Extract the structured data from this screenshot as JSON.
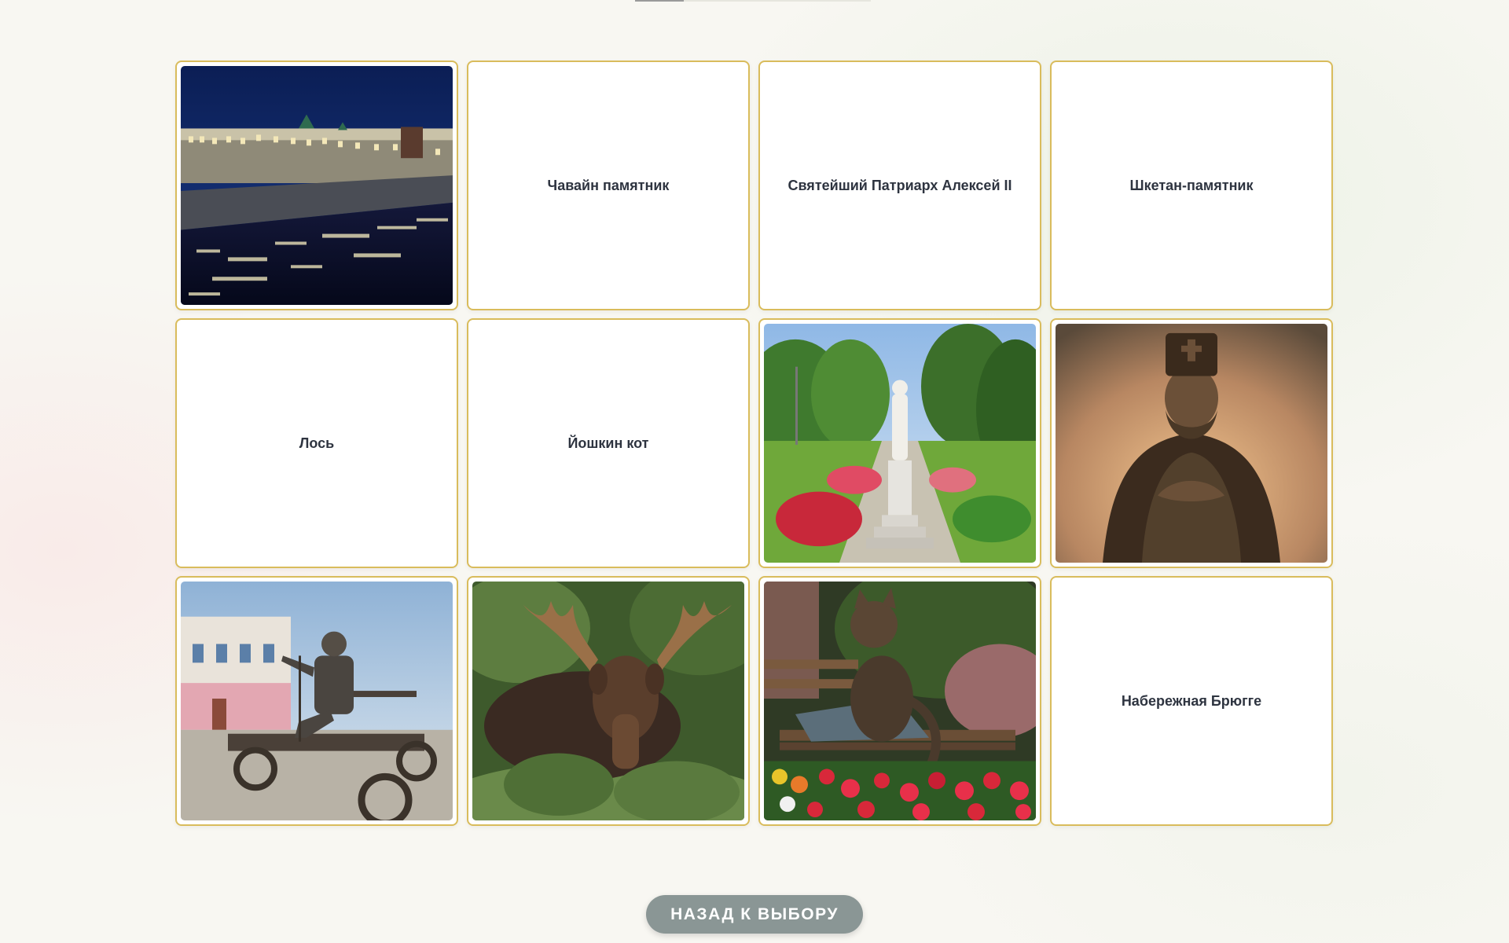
{
  "cards": [
    {
      "type": "image",
      "icon": "embankment-night-photo"
    },
    {
      "type": "text",
      "label": "Чавайн памятник"
    },
    {
      "type": "text",
      "label": "Святейший Патриарх Алексей II"
    },
    {
      "type": "text",
      "label": "Шкетан-памятник"
    },
    {
      "type": "text",
      "label": "Лось"
    },
    {
      "type": "text",
      "label": "Йошкин кот"
    },
    {
      "type": "image",
      "icon": "park-monument-photo"
    },
    {
      "type": "image",
      "icon": "saint-statue-photo"
    },
    {
      "type": "image",
      "icon": "trolley-statue-photo"
    },
    {
      "type": "image",
      "icon": "moose-photo"
    },
    {
      "type": "image",
      "icon": "cat-bench-statue-photo"
    },
    {
      "type": "text",
      "label": "Набережная Брюгге"
    }
  ],
  "back_button": {
    "label": "НАЗАД К ВЫБОРУ"
  },
  "colors": {
    "card_border": "#d9bc5c",
    "button_bg": "#8a9695",
    "label_text": "#2e3440"
  }
}
